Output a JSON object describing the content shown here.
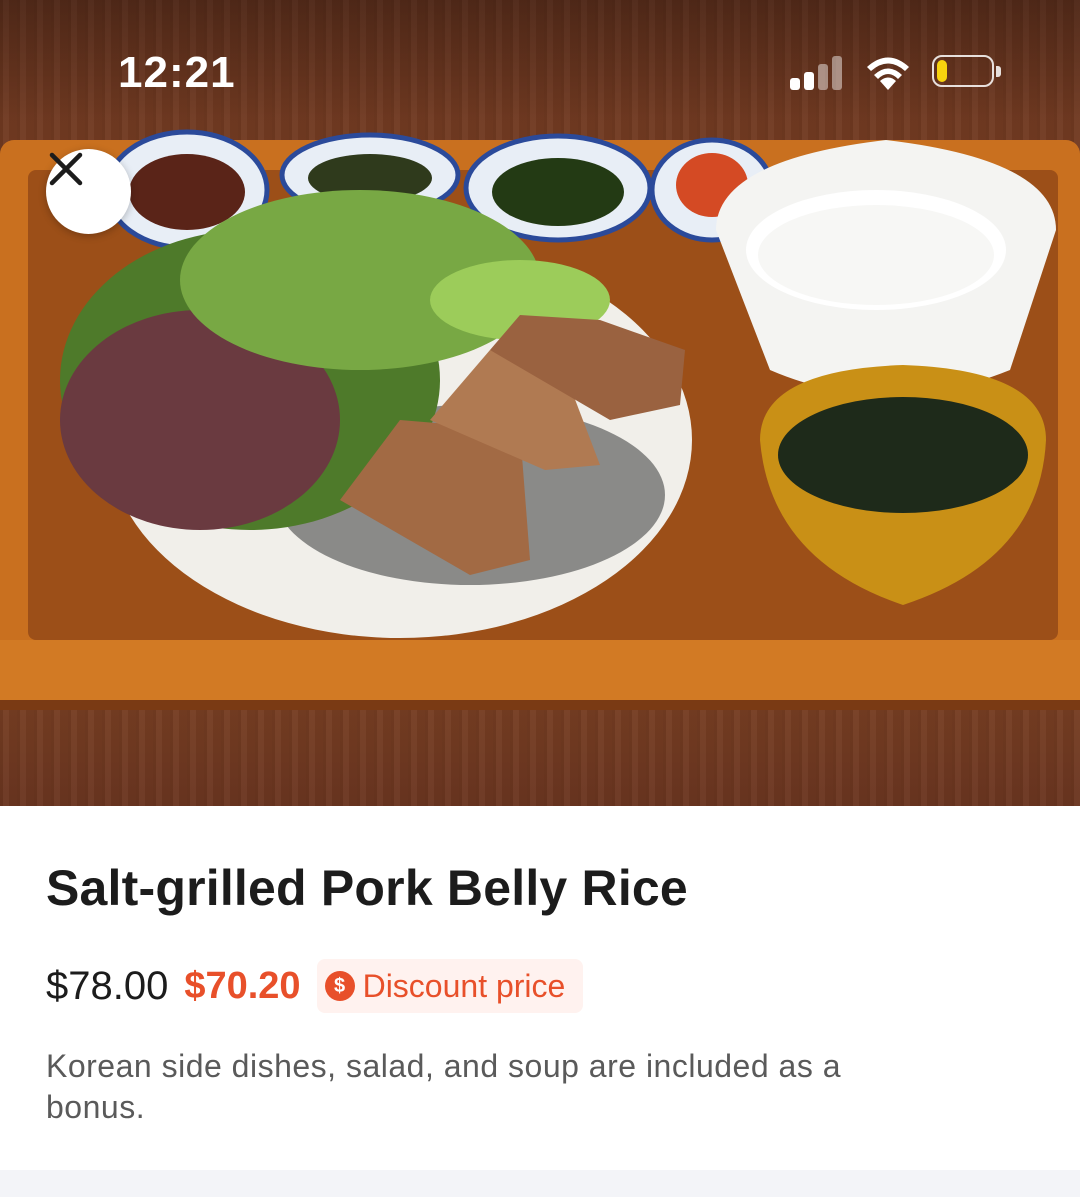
{
  "status_bar": {
    "time": "12:21",
    "icons": [
      "signal-icon",
      "wifi-icon",
      "battery-icon"
    ],
    "battery_level": 0.2,
    "battery_color": "#f7d30e"
  },
  "hero": {
    "close_icon": "close-icon"
  },
  "product": {
    "title": "Salt-grilled Pork Belly Rice",
    "original_price": "$78.00",
    "discount_price": "$70.20",
    "discount_icon": "dollar-icon",
    "discount_icon_glyph": "$",
    "discount_label": "Discount price",
    "description": "Korean side dishes, salad, and soup are included as a bonus."
  },
  "colors": {
    "accent": "#e8502a",
    "discount_tag_bg": "#fff2ef",
    "title_text": "#1c1c1c",
    "body_text": "#5a5a5a"
  }
}
